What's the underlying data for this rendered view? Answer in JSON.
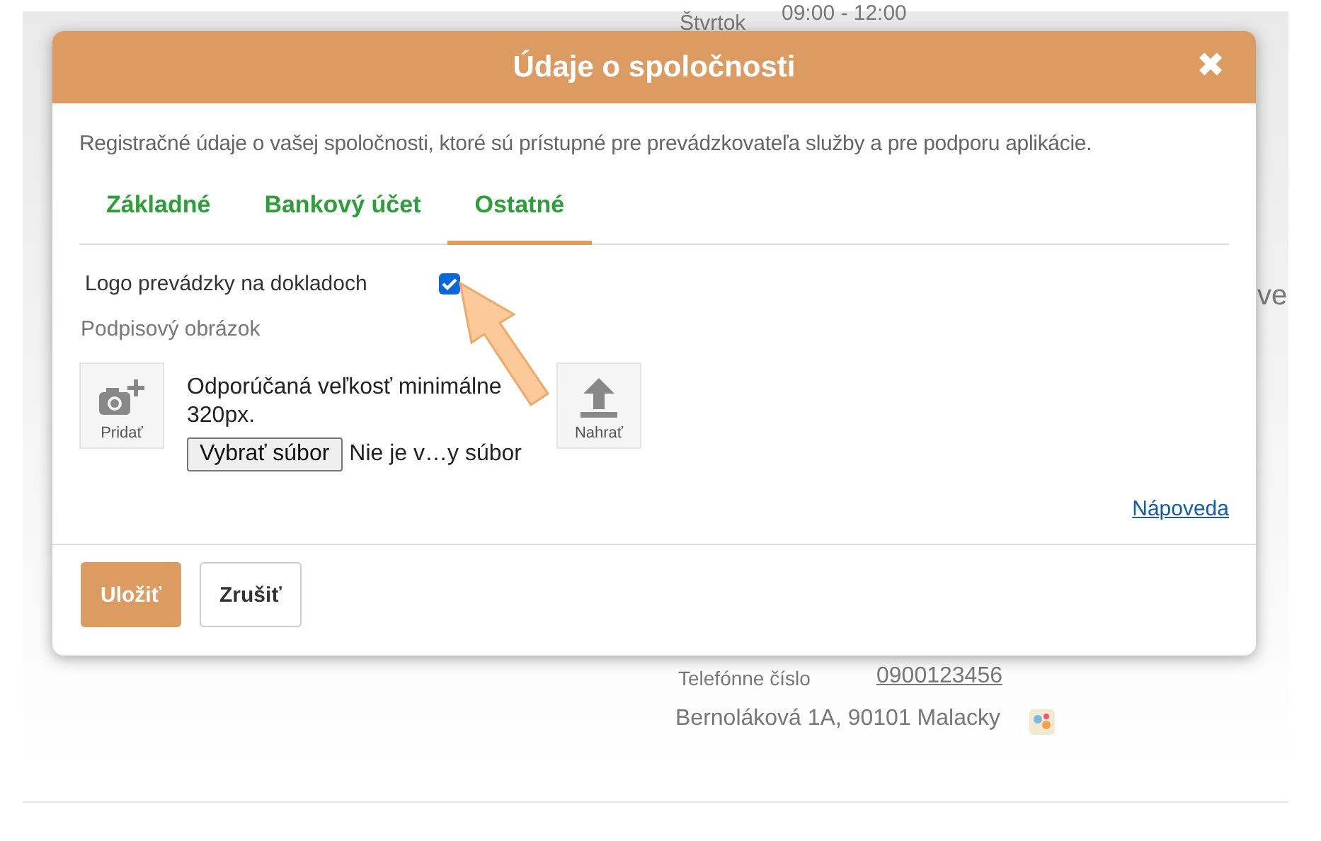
{
  "background": {
    "schedule": {
      "day": "Štvrtok",
      "hours": "09:00 - 12:00"
    },
    "cut_text": "ve",
    "phone_label": "Telefónne číslo",
    "phone": "0900123456",
    "address": "Bernoláková 1A, 90101 Malacky"
  },
  "dialog": {
    "title": "Údaje o spoločnosti",
    "close": "✖",
    "description": "Registračné údaje o vašej spoločnosti, ktoré sú prístupné pre prevádzkovateľa služby a pre podporu aplikácie.",
    "tabs": [
      {
        "label": "Základné",
        "selected": false
      },
      {
        "label": "Bankový účet",
        "selected": false
      },
      {
        "label": "Ostatné",
        "selected": true
      }
    ],
    "logo_option": {
      "label": "Logo prevádzky na dokladoch",
      "checked": true
    },
    "signature": {
      "label": "Podpisový obrázok",
      "add_label": "Pridať",
      "hint": "Odporúčaná veľkosť minimálne 320px.",
      "choose_button": "Vybrať súbor",
      "file_status": "Nie je v…y súbor",
      "upload_label": "Nahrať"
    },
    "help_link": "Nápoveda",
    "buttons": [
      {
        "label": "Uložiť",
        "kind": "primary"
      },
      {
        "label": "Zrušiť",
        "kind": "secondary"
      }
    ]
  }
}
